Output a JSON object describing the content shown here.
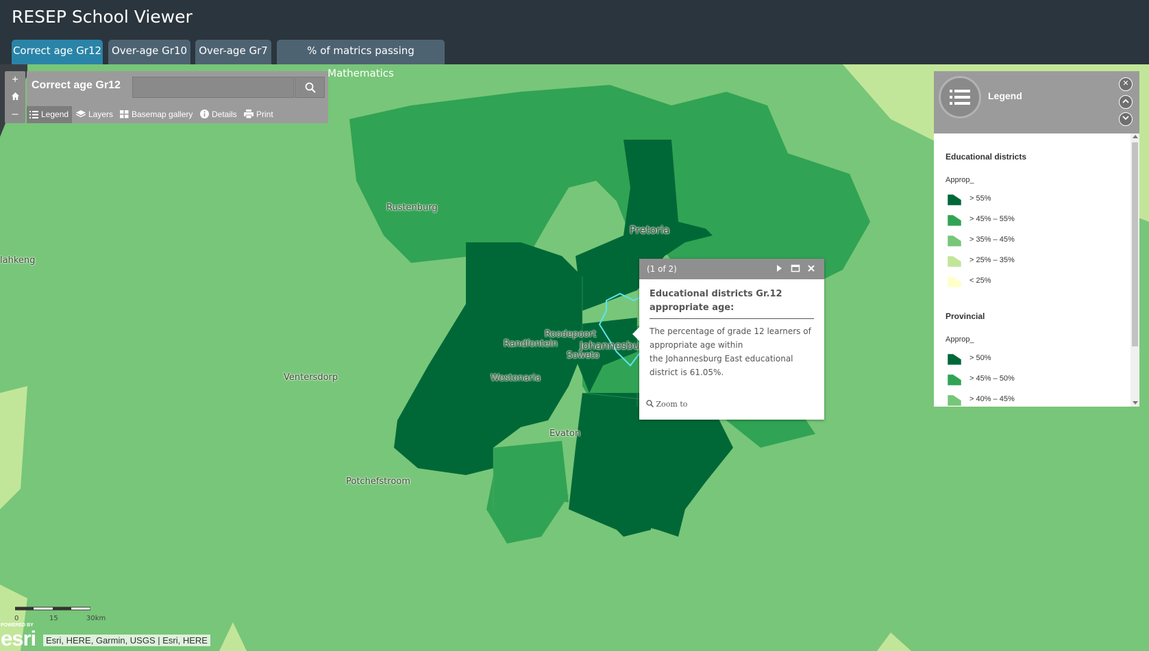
{
  "app": {
    "title": "RESEP School Viewer"
  },
  "tabs": [
    {
      "label": "Correct age Gr12",
      "active": true
    },
    {
      "label": "Over-age Gr10",
      "active": false
    },
    {
      "label": "Over-age Gr7",
      "active": false
    },
    {
      "label": "% of matrics passing Mathematics",
      "active": false
    }
  ],
  "zoom": {
    "in": "+",
    "home": "home-icon",
    "out": "–"
  },
  "map_panel": {
    "title": "Correct age Gr12",
    "search_value": "",
    "toolbar": [
      {
        "label": "Legend",
        "icon": "list-icon",
        "active": true
      },
      {
        "label": "Layers",
        "icon": "layers-icon",
        "active": false
      },
      {
        "label": "Basemap gallery",
        "icon": "grid-icon",
        "active": false
      },
      {
        "label": "Details",
        "icon": "info-icon",
        "active": false
      },
      {
        "label": "Print",
        "icon": "printer-icon",
        "active": false
      }
    ]
  },
  "legend": {
    "title": "Legend",
    "sections": [
      {
        "heading": "Educational districts",
        "field": "Approp_",
        "classes": [
          {
            "label": "> 55%",
            "color": "#006837"
          },
          {
            "label": "> 45% – 55%",
            "color": "#31a354"
          },
          {
            "label": "> 35% – 45%",
            "color": "#78c679"
          },
          {
            "label": "> 25% – 35%",
            "color": "#c2e699"
          },
          {
            "label": "< 25%",
            "color": "#ffffcc"
          }
        ]
      },
      {
        "heading": "Provincial",
        "field": "Approp_",
        "classes": [
          {
            "label": "> 50%",
            "color": "#006837"
          },
          {
            "label": "> 45% – 50%",
            "color": "#31a354"
          },
          {
            "label": "> 40% – 45%",
            "color": "#78c679"
          }
        ]
      }
    ]
  },
  "places": [
    {
      "name": "Rustenburg"
    },
    {
      "name": "Pretoria"
    },
    {
      "name": "lahkeng"
    },
    {
      "name": "Roodepoort"
    },
    {
      "name": "Randfontein"
    },
    {
      "name": "Johannesbu"
    },
    {
      "name": "Soweto"
    },
    {
      "name": "Westonaria"
    },
    {
      "name": "Ventersdorp"
    },
    {
      "name": "Evaton"
    },
    {
      "name": "Potchefstroom"
    }
  ],
  "popup": {
    "count": "(1 of 2)",
    "title": "Educational districts Gr.12 appropriate age:",
    "body_lines": [
      "The percentage of grade 12 learners of",
      "appropriate age within",
      "the Johannesburg East educational",
      "district is 61.05%."
    ],
    "zoom_label": "Zoom to"
  },
  "scale": {
    "labels": [
      "0",
      "15",
      "30km"
    ]
  },
  "attribution": {
    "powered_by": "POWERED BY",
    "logo": "esri",
    "text": "Esri, HERE, Garmin, USGS | Esri, HERE"
  }
}
